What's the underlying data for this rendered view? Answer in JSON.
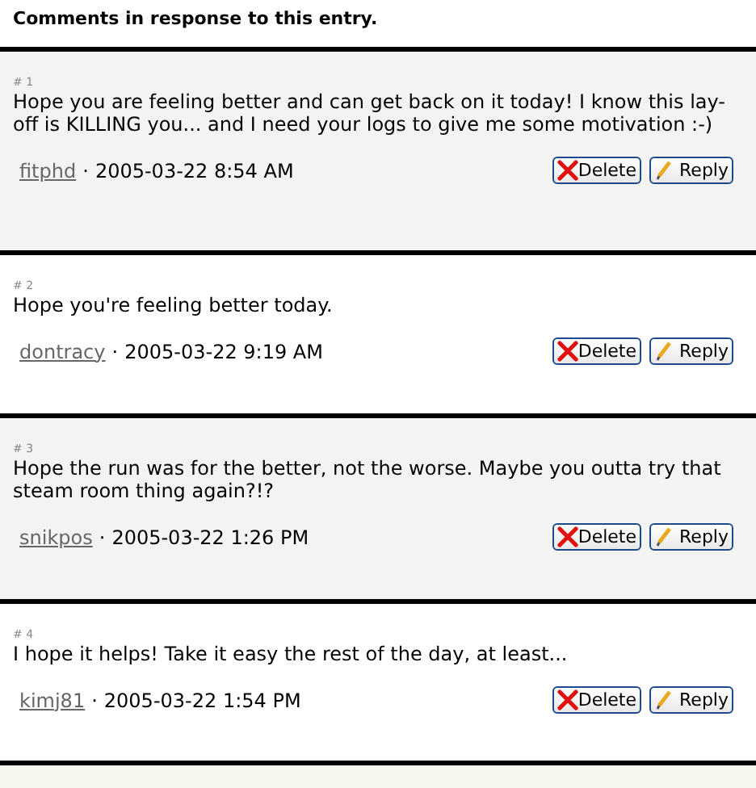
{
  "heading": "Comments in response to this entry.",
  "comments": [
    {
      "number": "# 1",
      "text": "Hope you are feeling better and can get back on it today! I know this lay-off is KILLING you... and I need your logs to give me some motivation :-)",
      "author": "fitphd",
      "separator": "·",
      "date": "2005-03-22 8:54 AM",
      "delete": "Delete",
      "reply": "Reply"
    },
    {
      "number": "# 2",
      "text": "Hope you're feeling better today.",
      "author": "dontracy",
      "separator": "·",
      "date": "2005-03-22 9:19 AM",
      "delete": "Delete",
      "reply": "Reply"
    },
    {
      "number": "# 3",
      "text": "Hope the run was for the better, not the worse. Maybe you outta try that steam room thing again?!?",
      "author": "snikpos",
      "separator": "·",
      "date": "2005-03-22 1:26 PM",
      "delete": "Delete",
      "reply": "Reply"
    },
    {
      "number": "# 4",
      "text": "I hope it helps! Take it easy the rest of the day, at least...",
      "author": "kimj81",
      "separator": "·",
      "date": "2005-03-22 1:54 PM",
      "delete": "Delete",
      "reply": "Reply"
    }
  ]
}
